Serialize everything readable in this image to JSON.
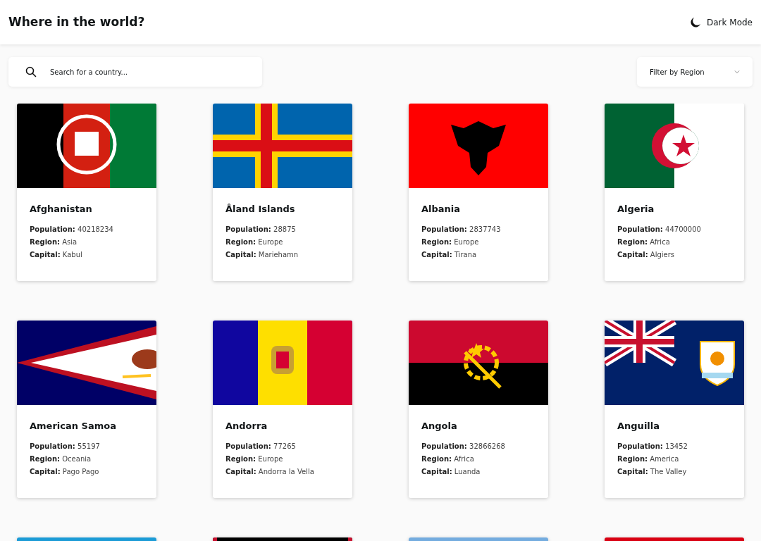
{
  "header": {
    "title": "Where in the world?",
    "theme_toggle": "Dark Mode"
  },
  "search": {
    "placeholder": "Search for a country..."
  },
  "filter": {
    "label": "Filter by Region"
  },
  "cards": [
    {
      "kind": "country",
      "name": "Afghanistan",
      "details": [
        "**Population:** 40218234",
        "**Region:** Asia",
        "**Capital:** Kabul"
      ]
    },
    {
      "kind": "country",
      "name": "Åland Islands",
      "details": [
        "**Population:** 28875",
        "**Region:** Europe",
        "**Capital:** Mariehamn"
      ]
    },
    {
      "kind": "country",
      "name": "Albania",
      "details": [
        "**Population:** 2837743",
        "**Region:** Europe",
        "**Capital:** Tirana"
      ]
    },
    {
      "kind": "country",
      "name": "Algeria",
      "details": [
        "**Population:** 44700000",
        "**Region:** Africa",
        "**Capital:** Algiers"
      ]
    },
    {
      "kind": "country",
      "name": "American Samoa",
      "details": [
        "**Population:** 55197",
        "**Region:** Oceania",
        "**Capital:** Pago Pago"
      ]
    },
    {
      "kind": "country",
      "name": "Andorra",
      "details": [
        "**Population:** 77265",
        "**Region:** Europe",
        "**Capital:** Andorra la Vella"
      ]
    },
    {
      "kind": "country",
      "name": "Angola",
      "details": [
        "**Population:** 32866268",
        "**Region:** Africa",
        "**Capital:** Luanda"
      ]
    },
    {
      "kind": "country",
      "name": "Anguilla",
      "details": [
        "**Population:** 13452",
        "**Region:** America",
        "**Capital:** The Valley"
      ]
    },
    {
      "kind": "picture"
    },
    {
      "kind": "picture"
    },
    {
      "kind": "picture"
    },
    {
      "kind": "picture"
    }
  ]
}
